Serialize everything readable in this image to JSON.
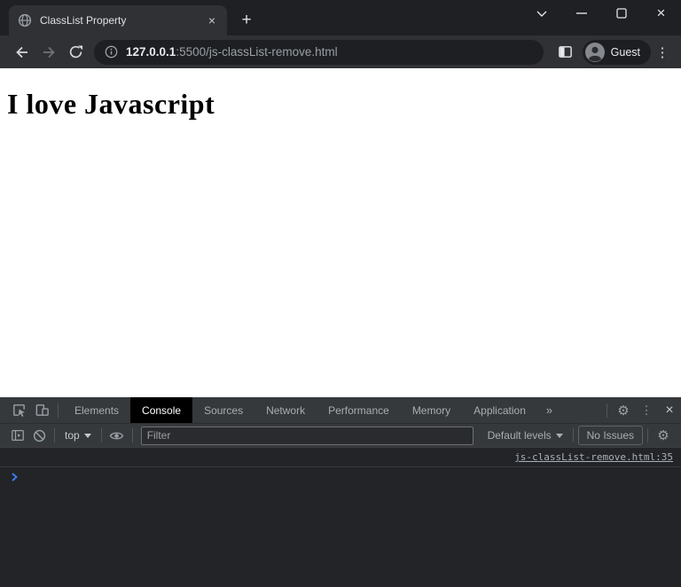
{
  "browser": {
    "tab_title": "ClassList Property",
    "url_host": "127.0.0.1",
    "url_path": ":5500/js-classList-remove.html",
    "profile_label": "Guest"
  },
  "icons": {
    "close": "×",
    "new_tab": "+",
    "kebab": "⋮",
    "gear": "⚙",
    "more_tabs": "»"
  },
  "page": {
    "heading": "I love Javascript"
  },
  "devtools": {
    "tabs": [
      "Elements",
      "Console",
      "Sources",
      "Network",
      "Performance",
      "Memory",
      "Application"
    ],
    "active_tab": "Console",
    "console_toolbar": {
      "context": "top",
      "filter_placeholder": "Filter",
      "levels": "Default levels",
      "issues": "No Issues"
    },
    "console": {
      "source_link": "js-classList-remove.html:35"
    }
  },
  "colors": {
    "prompt_blue": "#3B7BE8",
    "toolbar_dark": "#36393B",
    "chrome_frame": "#1F2023",
    "console_bg": "#232428"
  }
}
